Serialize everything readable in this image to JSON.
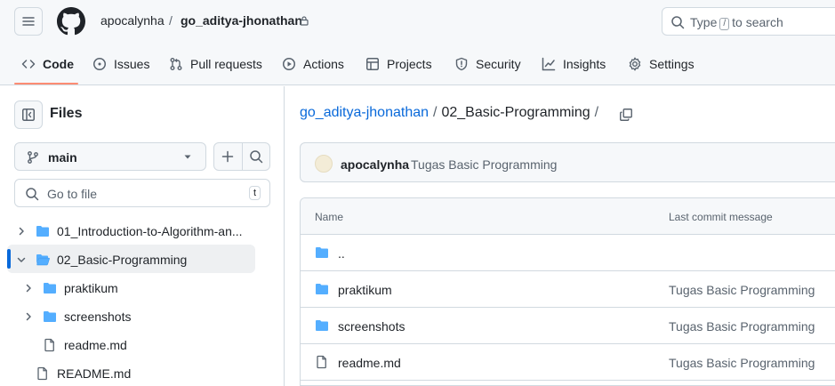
{
  "header": {
    "owner": "apocalynha",
    "separator": "/",
    "repo": "go_aditya-jhonathan",
    "search_prefix": "Type",
    "search_key": "/",
    "search_suffix": "to search"
  },
  "tabs": [
    {
      "label": "Code",
      "icon": "code-icon",
      "active": true
    },
    {
      "label": "Issues",
      "icon": "issue-icon"
    },
    {
      "label": "Pull requests",
      "icon": "pull-request-icon"
    },
    {
      "label": "Actions",
      "icon": "play-icon"
    },
    {
      "label": "Projects",
      "icon": "table-icon"
    },
    {
      "label": "Security",
      "icon": "shield-icon"
    },
    {
      "label": "Insights",
      "icon": "graph-icon"
    },
    {
      "label": "Settings",
      "icon": "gear-icon"
    }
  ],
  "sidebar": {
    "title": "Files",
    "branch": "main",
    "goto_placeholder": "Go to file",
    "goto_shortcut": "t",
    "tree": [
      {
        "label": "01_Introduction-to-Algorithm-an...",
        "type": "folder",
        "expanded": false
      },
      {
        "label": "02_Basic-Programming",
        "type": "folder-open",
        "expanded": true,
        "selected": true
      },
      {
        "label": "praktikum",
        "type": "folder",
        "expanded": false
      },
      {
        "label": "screenshots",
        "type": "folder",
        "expanded": false
      },
      {
        "label": "readme.md",
        "type": "file"
      },
      {
        "label": "README.md",
        "type": "file"
      }
    ]
  },
  "main": {
    "path_repo": "go_aditya-jhonathan",
    "path_sep": "/",
    "path_current": "02_Basic-Programming",
    "path_trailing": "/",
    "commit": {
      "author": "apocalynha",
      "message": "Tugas Basic Programming"
    },
    "table": {
      "col_name": "Name",
      "col_message": "Last commit message",
      "rows": [
        {
          "name": "..",
          "type": "folder",
          "message": ""
        },
        {
          "name": "praktikum",
          "type": "folder",
          "message": "Tugas Basic Programming"
        },
        {
          "name": "screenshots",
          "type": "folder",
          "message": "Tugas Basic Programming"
        },
        {
          "name": "readme.md",
          "type": "file",
          "message": "Tugas Basic Programming"
        }
      ]
    }
  },
  "colors": {
    "link": "#0969da",
    "folder": "#54aeff",
    "tab_underline": "#fd8c73",
    "muted": "#59636e"
  }
}
